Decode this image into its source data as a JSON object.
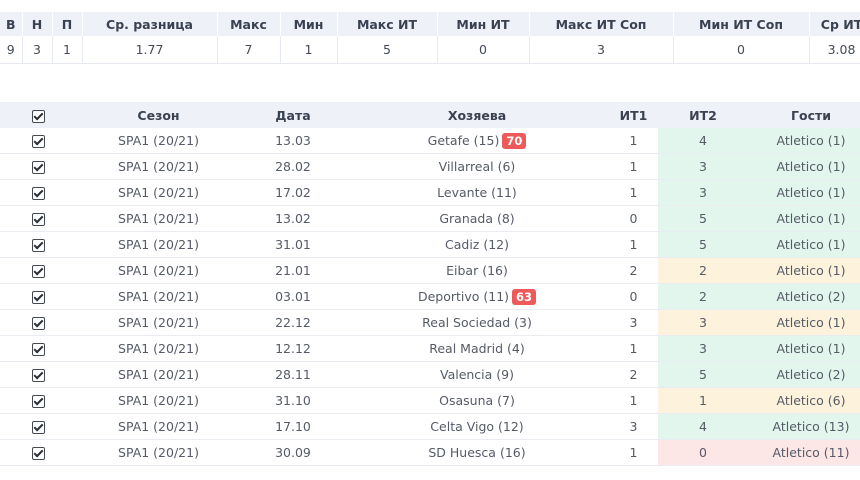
{
  "stats": {
    "headers": [
      "В",
      "Н",
      "П",
      "Ср. разница",
      "Макс",
      "Мин",
      "Макс ИТ",
      "Мин ИТ",
      "Макс ИТ Соп",
      "Мин ИТ Соп",
      "Ср ИТ"
    ],
    "values": [
      "9",
      "3",
      "1",
      "1.77",
      "7",
      "1",
      "5",
      "0",
      "3",
      "0",
      "3.08"
    ]
  },
  "matches": {
    "headers": {
      "season": "Сезон",
      "date": "Дата",
      "host": "Хозяева",
      "it1": "ИТ1",
      "it2": "ИТ2",
      "guest": "Гости"
    },
    "rows": [
      {
        "season": "SPA1 (20/21)",
        "date": "13.03",
        "host": "Getafe (15)",
        "badge": "70",
        "it1": "1",
        "it2": "4",
        "guest": "Atletico (1)",
        "tone": "green"
      },
      {
        "season": "SPA1 (20/21)",
        "date": "28.02",
        "host": "Villarreal (6)",
        "badge": "",
        "it1": "1",
        "it2": "3",
        "guest": "Atletico (1)",
        "tone": "green"
      },
      {
        "season": "SPA1 (20/21)",
        "date": "17.02",
        "host": "Levante (11)",
        "badge": "",
        "it1": "1",
        "it2": "3",
        "guest": "Atletico (1)",
        "tone": "green"
      },
      {
        "season": "SPA1 (20/21)",
        "date": "13.02",
        "host": "Granada (8)",
        "badge": "",
        "it1": "0",
        "it2": "5",
        "guest": "Atletico (1)",
        "tone": "green"
      },
      {
        "season": "SPA1 (20/21)",
        "date": "31.01",
        "host": "Cadiz (12)",
        "badge": "",
        "it1": "1",
        "it2": "5",
        "guest": "Atletico (1)",
        "tone": "green"
      },
      {
        "season": "SPA1 (20/21)",
        "date": "21.01",
        "host": "Eibar (16)",
        "badge": "",
        "it1": "2",
        "it2": "2",
        "guest": "Atletico (1)",
        "tone": "yellow"
      },
      {
        "season": "SPA1 (20/21)",
        "date": "03.01",
        "host": "Deportivo (11)",
        "badge": "63",
        "it1": "0",
        "it2": "2",
        "guest": "Atletico (2)",
        "tone": "green"
      },
      {
        "season": "SPA1 (20/21)",
        "date": "22.12",
        "host": "Real Sociedad (3)",
        "badge": "",
        "it1": "3",
        "it2": "3",
        "guest": "Atletico (1)",
        "tone": "yellow"
      },
      {
        "season": "SPA1 (20/21)",
        "date": "12.12",
        "host": "Real Madrid (4)",
        "badge": "",
        "it1": "1",
        "it2": "3",
        "guest": "Atletico (1)",
        "tone": "green"
      },
      {
        "season": "SPA1 (20/21)",
        "date": "28.11",
        "host": "Valencia (9)",
        "badge": "",
        "it1": "2",
        "it2": "5",
        "guest": "Atletico (2)",
        "tone": "green"
      },
      {
        "season": "SPA1 (20/21)",
        "date": "31.10",
        "host": "Osasuna (7)",
        "badge": "",
        "it1": "1",
        "it2": "1",
        "guest": "Atletico (6)",
        "tone": "yellow"
      },
      {
        "season": "SPA1 (20/21)",
        "date": "17.10",
        "host": "Celta Vigo (12)",
        "badge": "",
        "it1": "3",
        "it2": "4",
        "guest": "Atletico (13)",
        "tone": "green"
      },
      {
        "season": "SPA1 (20/21)",
        "date": "30.09",
        "host": "SD Huesca (16)",
        "badge": "",
        "it1": "1",
        "it2": "0",
        "guest": "Atletico (11)",
        "tone": "red"
      }
    ]
  },
  "colors": {
    "green": "#e3f6ee",
    "yellow": "#fdf3dd",
    "red": "#fde6e6",
    "badge": "#ee5a5a",
    "header_bg": "#eef1f8"
  }
}
